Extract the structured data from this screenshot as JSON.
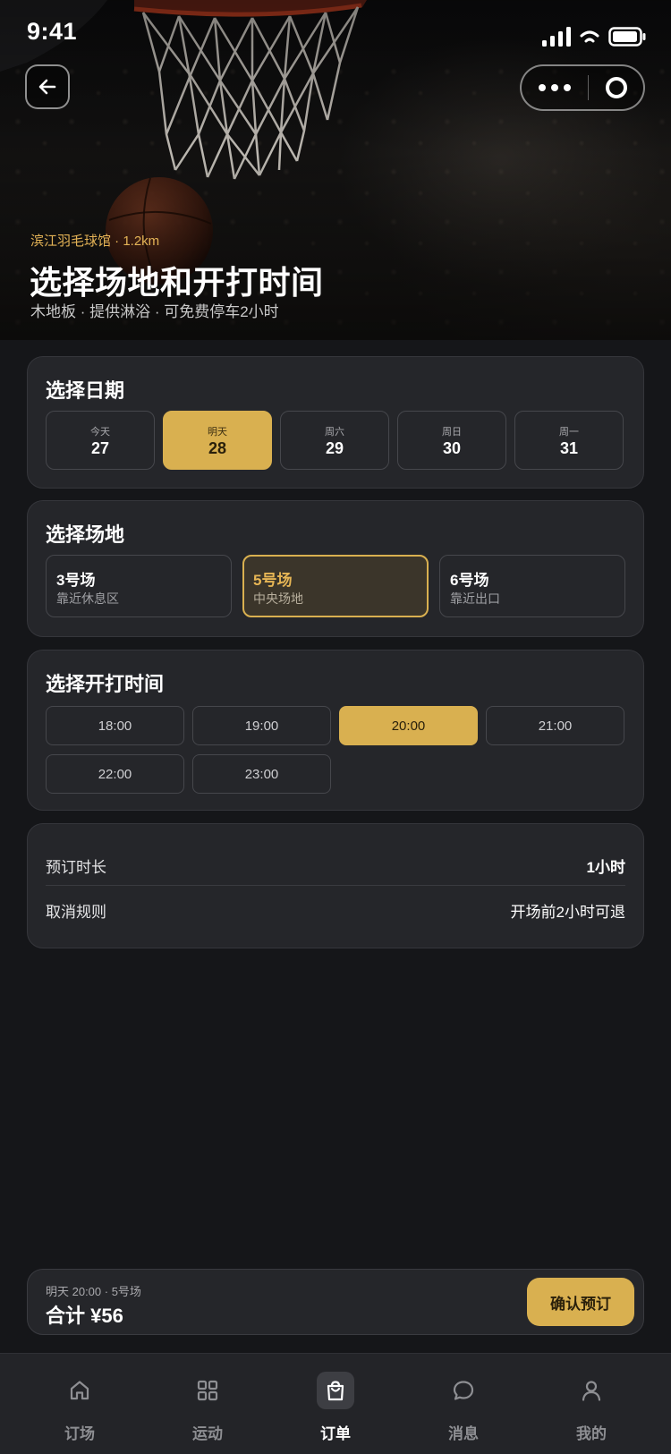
{
  "status_bar": {
    "time": "9:41"
  },
  "hero": {
    "venue": "滨江羽毛球馆 · 1.2km",
    "title": "选择场地和开打时间",
    "subtitle": "木地板 · 提供淋浴 · 可免费停车2小时"
  },
  "date_section": {
    "title": "选择日期",
    "dates": [
      {
        "weekday": "今天",
        "day": "27"
      },
      {
        "weekday": "明天",
        "day": "28"
      },
      {
        "weekday": "周六",
        "day": "29"
      },
      {
        "weekday": "周日",
        "day": "30"
      },
      {
        "weekday": "周一",
        "day": "31"
      }
    ],
    "selected_index": 1
  },
  "court_section": {
    "title": "选择场地",
    "courts": [
      {
        "name": "3号场",
        "desc": "靠近休息区"
      },
      {
        "name": "5号场",
        "desc": "中央场地"
      },
      {
        "name": "6号场",
        "desc": "靠近出口"
      }
    ],
    "selected_index": 1
  },
  "time_section": {
    "title": "选择开打时间",
    "times": [
      "18:00",
      "19:00",
      "20:00",
      "21:00",
      "22:00",
      "23:00"
    ],
    "selected_index": 2
  },
  "info": {
    "duration_label": "预订时长",
    "duration_value": "1小时",
    "cancel_label": "取消规则",
    "cancel_value": "开场前2小时可退"
  },
  "summary": {
    "detail": "明天 20:00 · 5号场",
    "total": "合计 ¥56",
    "confirm_label": "确认预订"
  },
  "tabbar": {
    "items": [
      {
        "label": "订场",
        "icon": "home-icon"
      },
      {
        "label": "运动",
        "icon": "grid-icon"
      },
      {
        "label": "订单",
        "icon": "shopping-bag-icon"
      },
      {
        "label": "消息",
        "icon": "chat-bubble-icon"
      },
      {
        "label": "我的",
        "icon": "person-icon"
      }
    ],
    "active_index": 2
  },
  "colors": {
    "accent": "#d9b050",
    "background": "#151619",
    "card": "#25262a"
  }
}
